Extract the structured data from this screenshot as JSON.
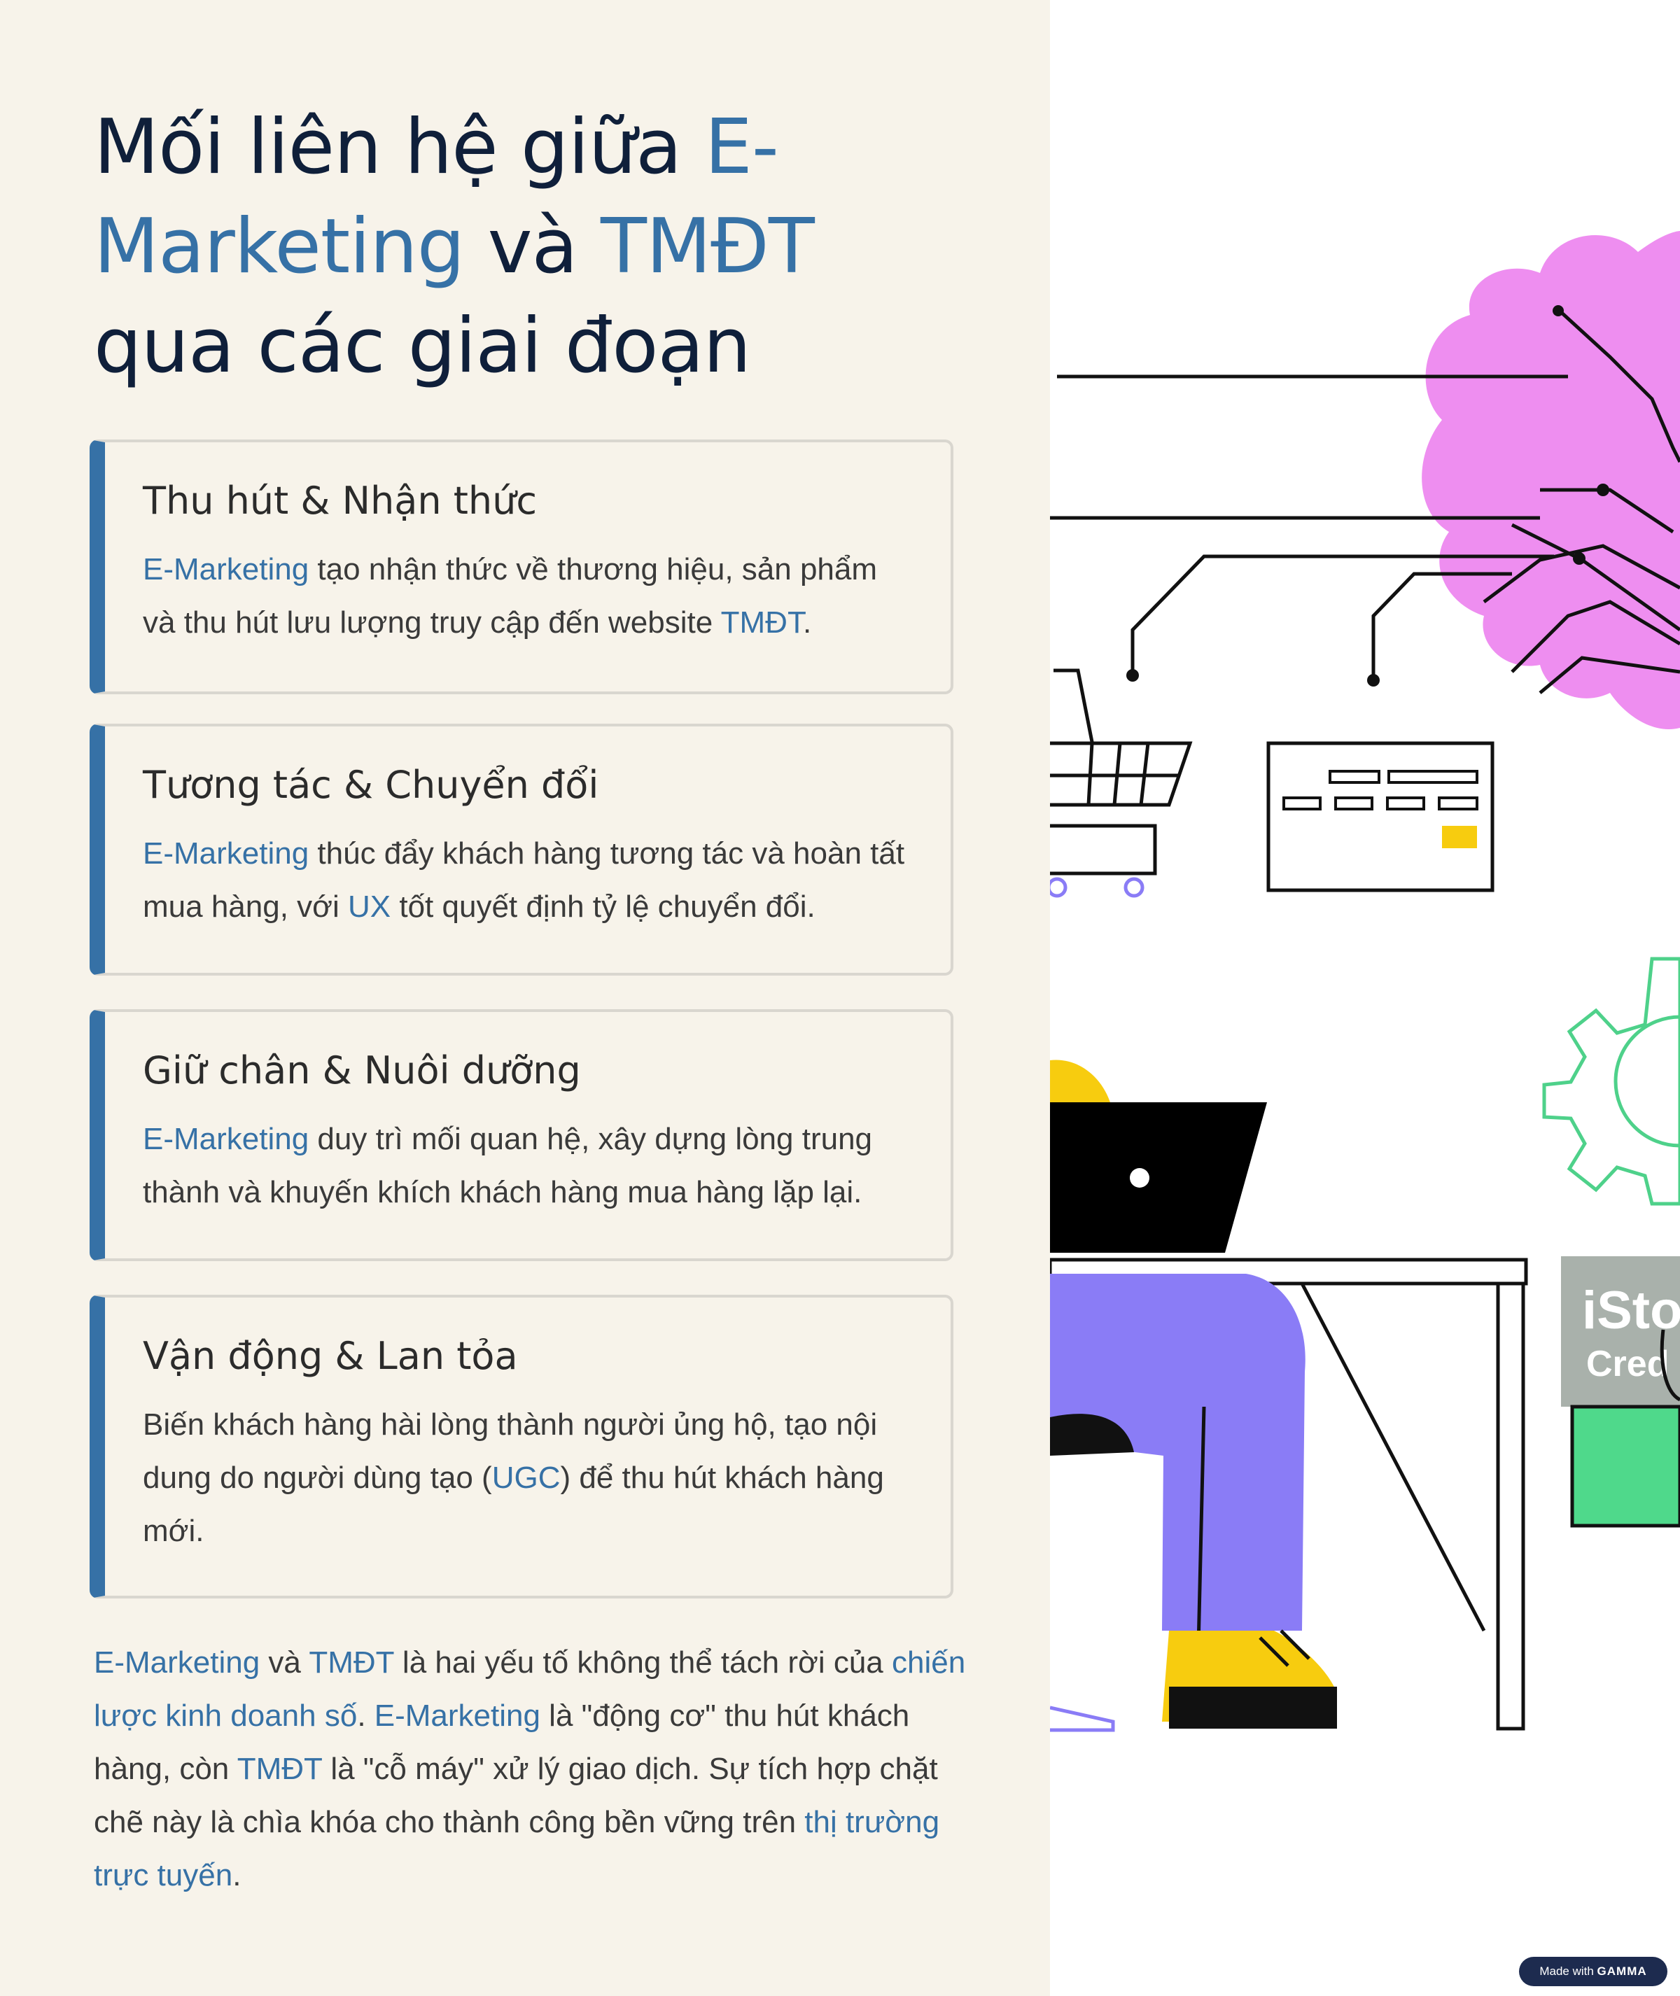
{
  "title": {
    "line1_prefix": "Mối liên hệ giữa ",
    "line1_hl": "E-",
    "line2_hl": "Marketing",
    "line2_mid": " và ",
    "line2_hl2": "TMĐT",
    "line3": "qua các giai đoạn"
  },
  "cards": [
    {
      "heading": "Thu hút & Nhận thức",
      "hl1": "E-Marketing",
      "text1": " tạo nhận thức về thương hiệu, sản phẩm và thu hút lưu lượng truy cập đến website ",
      "hl2": "TMĐT",
      "text2": "."
    },
    {
      "heading": "Tương tác & Chuyển đổi",
      "hl1": "E-Marketing",
      "text1": " thúc đẩy khách hàng tương tác và hoàn tất mua hàng, với ",
      "hl2": "UX",
      "text2": " tốt quyết định tỷ lệ chuyển đổi."
    },
    {
      "heading": "Giữ chân & Nuôi dưỡng",
      "hl1": "E-Marketing",
      "text1": " duy trì mối quan hệ, xây dựng lòng trung thành và khuyến khích khách hàng mua hàng lặp lại."
    },
    {
      "heading": "Vận động & Lan tỏa",
      "text1": "Biến khách hàng hài lòng thành người ủng hộ, tạo nội dung do người dùng tạo (",
      "hl1": "UGC",
      "text2": ") để thu hút khách hàng mới."
    }
  ],
  "closing": {
    "p1": "E-Marketing",
    "p2": " và ",
    "p3": "TMĐT",
    "p4": " là hai yếu tố không thể tách rời của ",
    "p5": "chiến lược kinh doanh số",
    "p6": ". ",
    "p7": "E-Marketing",
    "p8": " là \"động cơ\" thu hút khách hàng, còn ",
    "p9": "TMĐT",
    "p10": " là \"cỗ máy\" xử lý giao dịch. Sự tích hợp chặt chẽ này là chìa khóa cho thành công bền vững trên ",
    "p11": "thị trường trực tuyến",
    "p12": "."
  },
  "illustration": {
    "watermark_line1": "iSto",
    "watermark_line2": "Cred",
    "colors": {
      "brain": "#ee8ef0",
      "person": "#8a7cf6",
      "shoes": "#f7cc0f",
      "gear": "#4ed18a",
      "bag": "#4fd98b",
      "card_chip": "#f7cc0f"
    }
  },
  "badge": {
    "prefix": "Made with ",
    "brand": "GAMMA"
  },
  "colors": {
    "accent": "#3671a6",
    "title": "#0f1f3a",
    "panel_bg": "#f7f3ea"
  }
}
